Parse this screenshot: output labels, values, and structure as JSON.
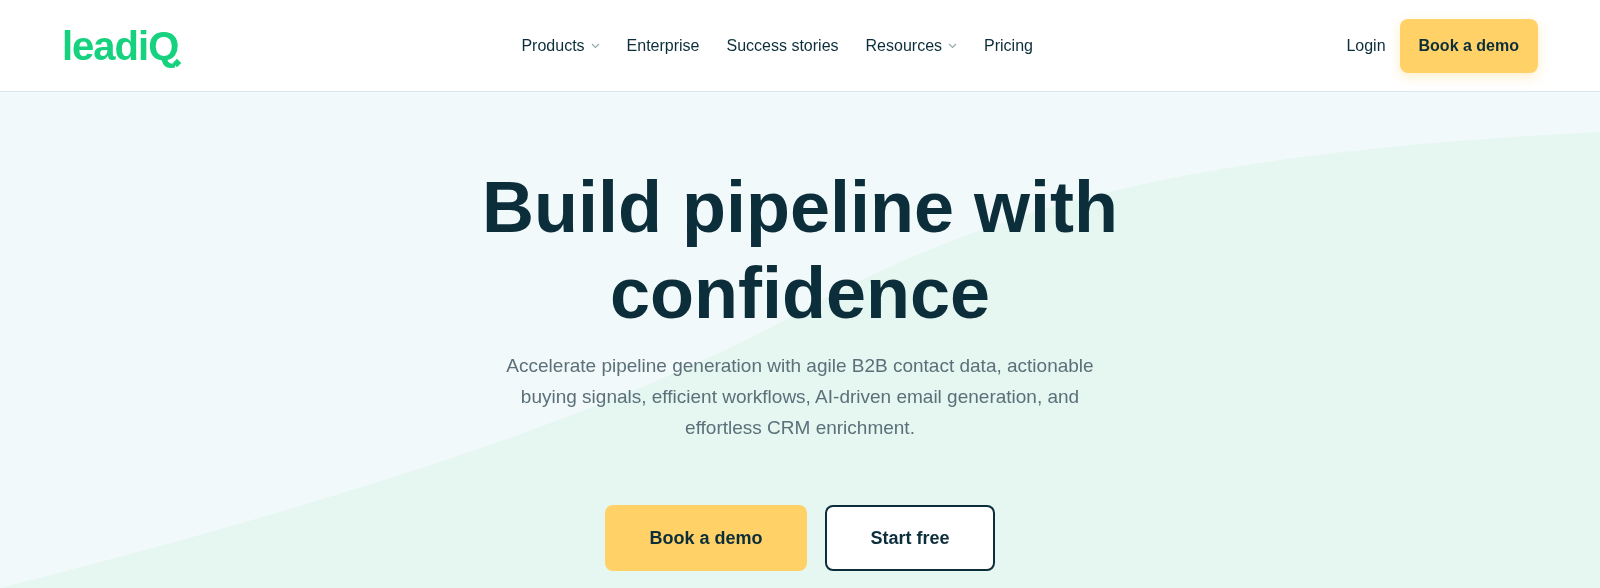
{
  "header": {
    "logo": "leadiQ",
    "nav": [
      {
        "label": "Products",
        "has_menu": true
      },
      {
        "label": "Enterprise",
        "has_menu": false
      },
      {
        "label": "Success stories",
        "has_menu": false
      },
      {
        "label": "Resources",
        "has_menu": true
      },
      {
        "label": "Pricing",
        "has_menu": false
      }
    ],
    "login": "Login",
    "cta": "Book a demo"
  },
  "hero": {
    "heading": "Build pipeline with confidence",
    "subheading": "Accelerate pipeline generation with agile B2B contact data, actionable buying signals, efficient workflows, AI-driven email generation, and effortless CRM enrichment.",
    "primary_button": "Book a demo",
    "secondary_button": "Start free"
  }
}
